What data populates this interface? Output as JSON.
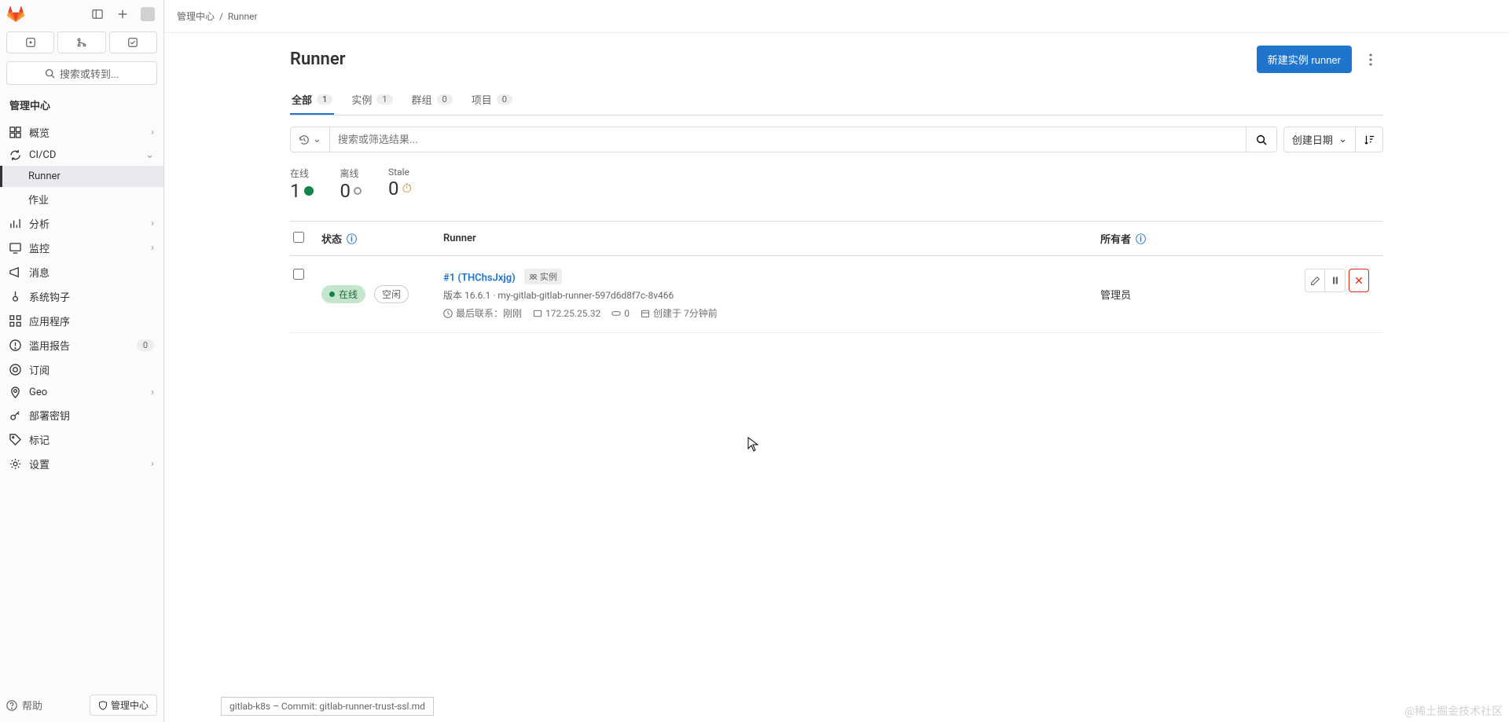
{
  "sidebar": {
    "search": "搜索或转到...",
    "section": "管理中心",
    "items": [
      {
        "icon": "overview-icon",
        "label": "概览",
        "chev": true
      },
      {
        "icon": "cicd-icon",
        "label": "CI/CD",
        "chev": true,
        "expanded": true,
        "children": [
          {
            "label": "Runner",
            "active": true
          },
          {
            "label": "作业"
          }
        ]
      },
      {
        "icon": "analytics-icon",
        "label": "分析",
        "chev": true
      },
      {
        "icon": "monitor-icon",
        "label": "监控",
        "chev": true
      },
      {
        "icon": "message-icon",
        "label": "消息"
      },
      {
        "icon": "hooks-icon",
        "label": "系统钩子"
      },
      {
        "icon": "apps-icon",
        "label": "应用程序"
      },
      {
        "icon": "abuse-icon",
        "label": "滥用报告",
        "badge": "0"
      },
      {
        "icon": "subscribe-icon",
        "label": "订阅"
      },
      {
        "icon": "geo-icon",
        "label": "Geo",
        "chev": true
      },
      {
        "icon": "key-icon",
        "label": "部署密钥"
      },
      {
        "icon": "label-icon",
        "label": "标记"
      },
      {
        "icon": "settings-icon",
        "label": "设置",
        "chev": true
      }
    ],
    "help": "帮助",
    "admin_pill": "管理中心"
  },
  "breadcrumbs": {
    "root": "管理中心",
    "current": "Runner"
  },
  "page": {
    "title": "Runner",
    "new_btn": "新建实例 runner"
  },
  "tabs": [
    {
      "label": "全部",
      "count": "1",
      "active": true
    },
    {
      "label": "实例",
      "count": "1"
    },
    {
      "label": "群组",
      "count": "0"
    },
    {
      "label": "项目",
      "count": "0"
    }
  ],
  "filter": {
    "placeholder": "搜索或筛选结果...",
    "sort": "创建日期"
  },
  "stats": {
    "online": {
      "label": "在线",
      "value": "1"
    },
    "offline": {
      "label": "离线",
      "value": "0"
    },
    "stale": {
      "label": "Stale",
      "value": "0"
    }
  },
  "table": {
    "status": "状态",
    "runner": "Runner",
    "owner": "所有者"
  },
  "row": {
    "status_online": "在线",
    "status_idle": "空闲",
    "id_link": "#1 (THChsJxjg)",
    "type": "实例",
    "version": "版本 16.6.1 · my-gitlab-gitlab-runner-597d6d8f7c-8v466",
    "contact": "最后联系：刚刚",
    "ip": "172.25.25.32",
    "jobs": "0",
    "created": "创建于 7分钟前",
    "owner": "管理员"
  },
  "tooltip": "gitlab-k8s – Commit: gitlab-runner-trust-ssl.md",
  "watermark": "@稀土掘金技术社区"
}
